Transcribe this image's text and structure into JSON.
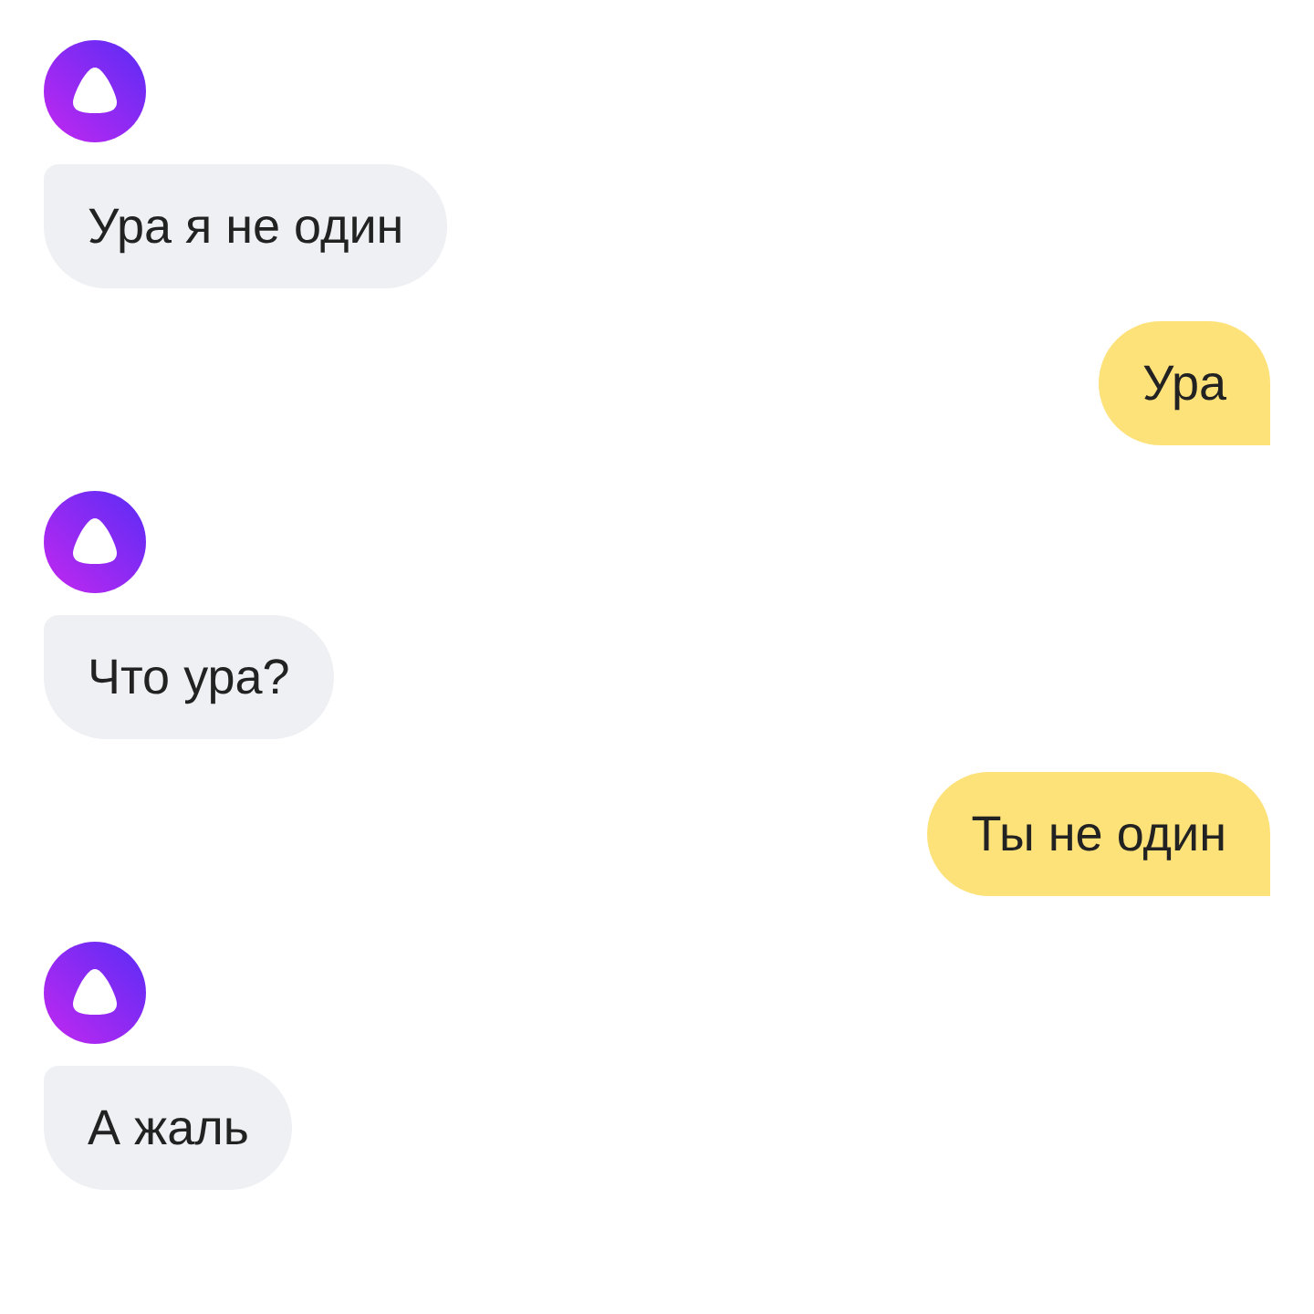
{
  "messages": [
    {
      "kind": "bot",
      "text": "Ура я не один"
    },
    {
      "kind": "user",
      "text": "Ура"
    },
    {
      "kind": "bot",
      "text": "Что ура?"
    },
    {
      "kind": "user",
      "text": "Ты не один"
    },
    {
      "kind": "bot",
      "text": "А жаль"
    }
  ]
}
